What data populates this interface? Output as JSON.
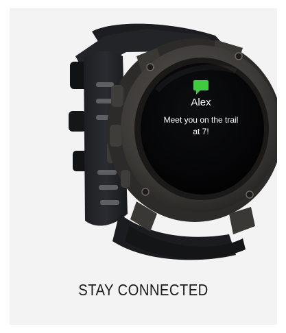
{
  "watch": {
    "notification_icon": "message-icon",
    "sender": "Alex",
    "message_line1": "Meet you on the trail",
    "message_line2": "at 7!",
    "icon_color": "#3ecb3e"
  },
  "caption": "STAY CONNECTED"
}
